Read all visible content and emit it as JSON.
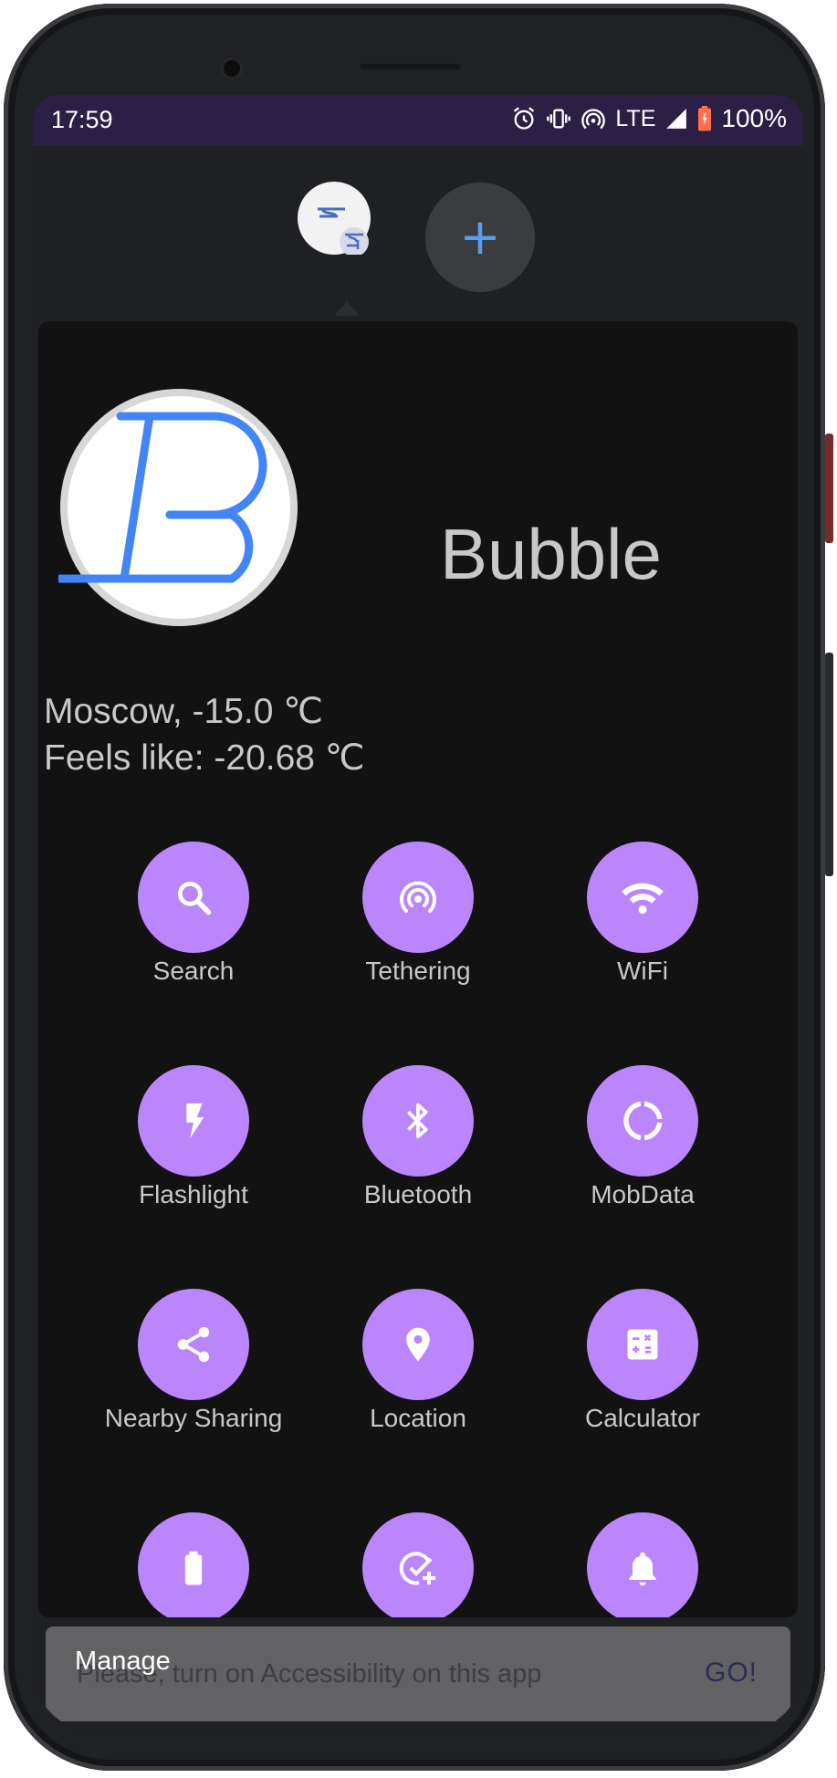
{
  "status_bar": {
    "time": "17:59",
    "network": "LTE",
    "battery": "100%"
  },
  "bubbles": {
    "add_label": "+"
  },
  "app": {
    "title": "Bubble"
  },
  "weather": {
    "line1": "Moscow, -15.0 ℃",
    "line2": "Feels like: -20.68 ℃"
  },
  "tiles": [
    {
      "label": "Search",
      "icon": "search-icon"
    },
    {
      "label": "Tethering",
      "icon": "hotspot-icon"
    },
    {
      "label": "WiFi",
      "icon": "wifi-icon"
    },
    {
      "label": "Flashlight",
      "icon": "flash-icon"
    },
    {
      "label": "Bluetooth",
      "icon": "bluetooth-icon"
    },
    {
      "label": "MobData",
      "icon": "data-ring-icon"
    },
    {
      "label": "Nearby Sharing",
      "icon": "share-icon"
    },
    {
      "label": "Location",
      "icon": "location-pin-icon"
    },
    {
      "label": "Calculator",
      "icon": "calculator-icon"
    },
    {
      "label": "",
      "icon": "battery-icon"
    },
    {
      "label": "",
      "icon": "task-add-icon"
    },
    {
      "label": "",
      "icon": "bell-icon"
    }
  ],
  "snackbar": {
    "message": "Please, turn on Accessibility on this app",
    "manage": "Manage",
    "action": "GO!"
  },
  "colors": {
    "accent": "#bb86fc",
    "panel_bg": "#121213",
    "status_bar_bg": "#2c1f45",
    "logo_blue": "#4285f4"
  }
}
